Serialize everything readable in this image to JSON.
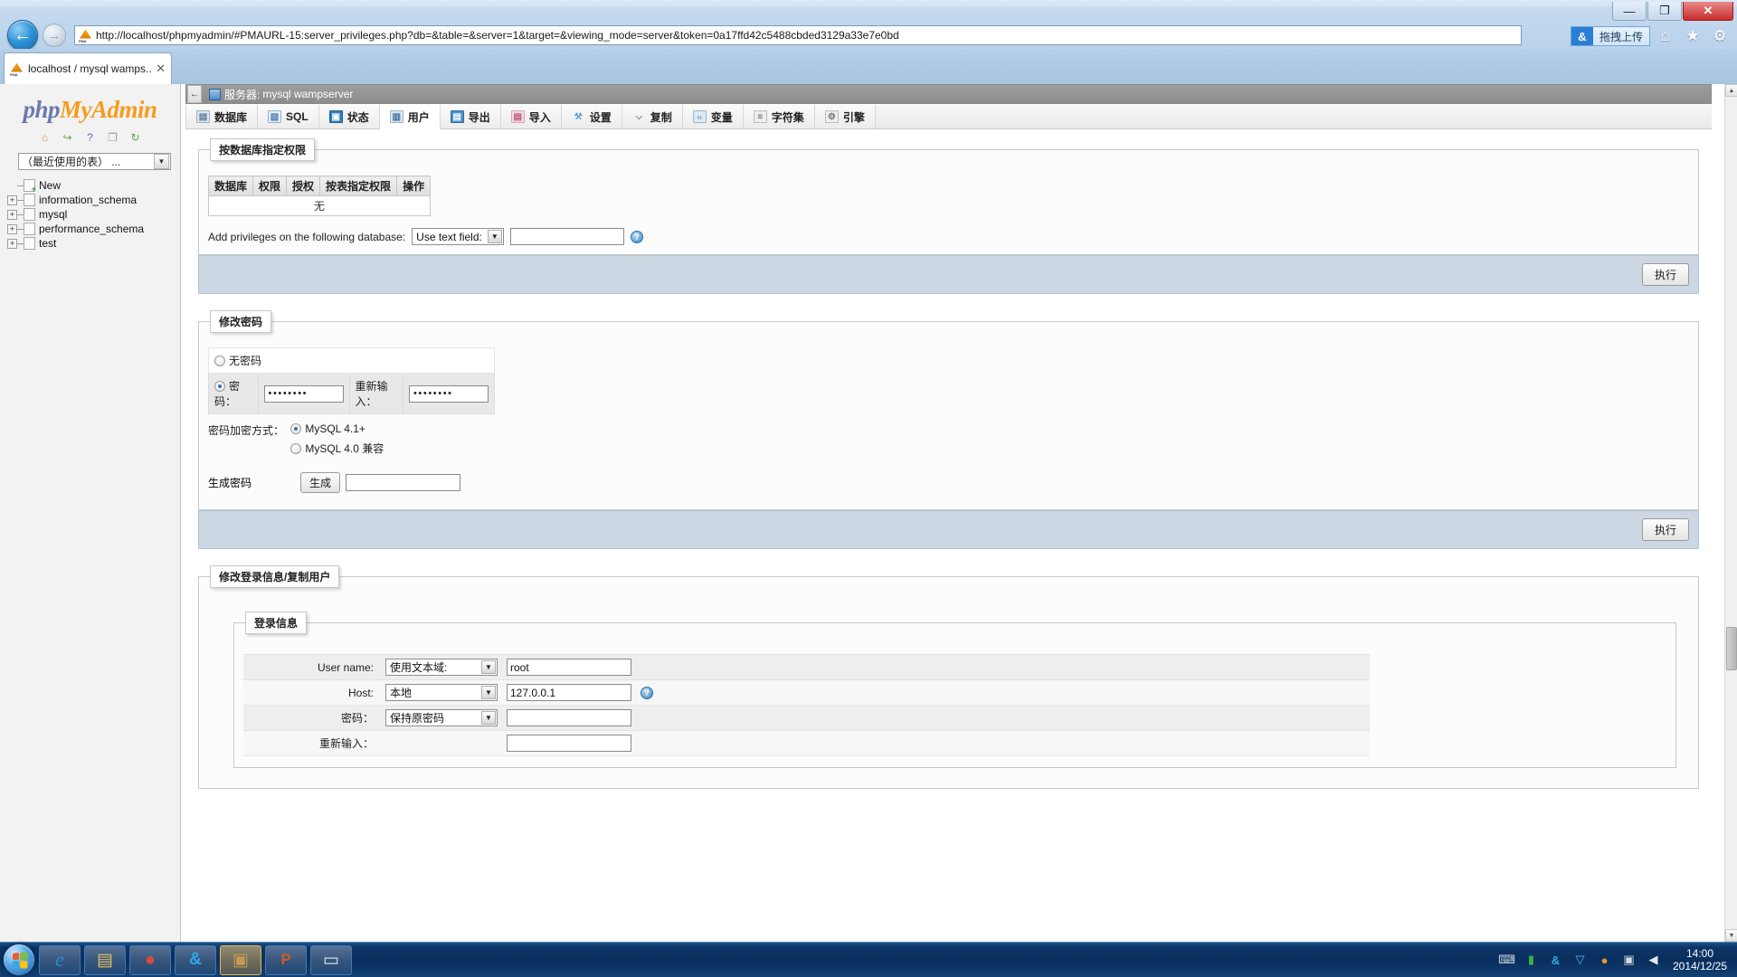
{
  "browser": {
    "window_controls": {
      "minimize": "—",
      "maximize": "❐",
      "close": "✕"
    },
    "back_icon": "←",
    "forward_icon": "→",
    "url": "http://localhost/phpmyadmin/#PMAURL-15:server_privileges.php?db=&table=&server=1&target=&viewing_mode=server&token=0a17ffd42c5488cbded3129a33e7e0bd",
    "tab_title": "localhost / mysql wamps...",
    "tab_close": "✕",
    "baidu_button": "拖拽上传",
    "baidu_icon_glyph": "&",
    "tools": {
      "home": "⌂",
      "favorites": "★",
      "settings": "⚙"
    }
  },
  "sidebar": {
    "logo": {
      "php": "php",
      "my": "My",
      "admin": "Admin"
    },
    "icons": [
      {
        "name": "home-icon",
        "glyph": "⌂"
      },
      {
        "name": "logout-icon",
        "glyph": "↪"
      },
      {
        "name": "help-icon",
        "glyph": "?"
      },
      {
        "name": "docs-icon",
        "glyph": "❐"
      },
      {
        "name": "reload-icon",
        "glyph": "↻"
      }
    ],
    "recent_tables_select": "（最近使用的表） ...",
    "select_arrow": "▼",
    "tree": [
      {
        "label": "New",
        "expandable": false,
        "is_new": true
      },
      {
        "label": "information_schema",
        "expandable": true,
        "is_new": false
      },
      {
        "label": "mysql",
        "expandable": true,
        "is_new": false
      },
      {
        "label": "performance_schema",
        "expandable": true,
        "is_new": false
      },
      {
        "label": "test",
        "expandable": true,
        "is_new": false
      }
    ],
    "expand_glyph": "+"
  },
  "server_header": {
    "collapse_glyph": "←",
    "label": "服务器:",
    "value": "mysql wampserver"
  },
  "nav_tabs": [
    {
      "label": "数据库",
      "icon": "database-icon",
      "glyph": "▤",
      "color": "#7b93ab",
      "active": false
    },
    {
      "label": "SQL",
      "icon": "sql-icon",
      "glyph": "▧",
      "color": "#6d8ba8",
      "active": false
    },
    {
      "label": "状态",
      "icon": "status-icon",
      "glyph": "▣",
      "color": "#2f7fbf",
      "active": false
    },
    {
      "label": "用户",
      "icon": "users-icon",
      "glyph": "▥",
      "color": "#5b7ea1",
      "active": true
    },
    {
      "label": "导出",
      "icon": "export-icon",
      "glyph": "▤",
      "color": "#4a90c8",
      "active": false
    },
    {
      "label": "导入",
      "icon": "import-icon",
      "glyph": "▤",
      "color": "#c2557a",
      "active": false
    },
    {
      "label": "设置",
      "icon": "settings-icon",
      "glyph": "⚒",
      "color": "#7aa3cc",
      "active": false
    },
    {
      "label": "复制",
      "icon": "replication-icon",
      "glyph": "⌵",
      "color": "#8a8a8a",
      "active": false
    },
    {
      "label": "变量",
      "icon": "variables-icon",
      "glyph": "‹›",
      "color": "#4a8fc0",
      "active": false
    },
    {
      "label": "字符集",
      "icon": "charset-icon",
      "glyph": "≡",
      "color": "#8a8a8a",
      "active": false
    },
    {
      "label": "引擎",
      "icon": "engines-icon",
      "glyph": "⚙",
      "color": "#9a9a9a",
      "active": false
    }
  ],
  "db_privileges": {
    "legend": "按数据库指定权限",
    "columns": [
      "数据库",
      "权限",
      "授权",
      "按表指定权限",
      "操作"
    ],
    "empty_text": "无",
    "add_label": "Add privileges on the following database:",
    "add_select_value": "Use text field:",
    "add_input_value": "",
    "help_glyph": "?",
    "submit_label": "执行"
  },
  "change_password": {
    "legend": "修改密码",
    "no_password_label": "无密码",
    "no_password_checked": false,
    "password_label": "密码：",
    "password_checked": true,
    "password_value": "••••••••",
    "reenter_label": "重新输入：",
    "reenter_value": "••••••••",
    "encryption_label": "密码加密方式：",
    "encryption_options": [
      {
        "label": "MySQL 4.1+",
        "checked": true
      },
      {
        "label": "MySQL 4.0 兼容",
        "checked": false
      }
    ],
    "generate_label": "生成密码",
    "generate_button": "生成",
    "generate_value": "",
    "submit_label": "执行"
  },
  "change_login": {
    "legend": "修改登录信息/复制用户",
    "inner_legend": "登录信息",
    "rows": [
      {
        "label": "User name:",
        "select": "使用文本域:",
        "value": "root",
        "has_help": false
      },
      {
        "label": "Host:",
        "select": "本地",
        "value": "127.0.0.1",
        "has_help": true
      },
      {
        "label": "密码：",
        "select": "保持原密码",
        "value": "",
        "has_help": false
      },
      {
        "label": "重新输入：",
        "select": null,
        "value": "",
        "has_help": false
      }
    ],
    "help_glyph": "?"
  },
  "scrollbar": {
    "up_glyph": "▲",
    "down_glyph": "▼"
  },
  "taskbar": {
    "items": [
      {
        "name": "internet-explorer",
        "glyph": "e",
        "color": "#2a8ad4",
        "active": false
      },
      {
        "name": "file-explorer",
        "glyph": "▤",
        "color": "#e8c060",
        "active": false
      },
      {
        "name": "google-chrome",
        "glyph": "●",
        "color": "#d74b3e",
        "active": false
      },
      {
        "name": "baidu-netdisk",
        "glyph": "&",
        "color": "#2fa8e8",
        "active": false
      },
      {
        "name": "photo-viewer",
        "glyph": "▣",
        "color": "#c89a50",
        "active": true
      },
      {
        "name": "powerpoint",
        "glyph": "P",
        "color": "#d05a28",
        "active": false
      },
      {
        "name": "notepad-app",
        "glyph": "▭",
        "color": "#dfe6ee",
        "active": false
      }
    ],
    "tray": [
      {
        "name": "keyboard-ime-icon",
        "glyph": "⌨",
        "color": "#cfd8e4"
      },
      {
        "name": "green-shield-icon",
        "glyph": "▮",
        "color": "#3fae3f"
      },
      {
        "name": "baidu-tray-icon",
        "glyph": "&",
        "color": "#2fa8e8"
      },
      {
        "name": "security-shield-icon",
        "glyph": "▽",
        "color": "#49c0e8"
      },
      {
        "name": "qq-penguin-icon",
        "glyph": "●",
        "color": "#e8943a"
      },
      {
        "name": "network-icon",
        "glyph": "▣",
        "color": "#d8dde4"
      },
      {
        "name": "volume-icon",
        "glyph": "◀",
        "color": "#e4e9f0"
      }
    ],
    "clock_time": "14:00",
    "clock_date": "2014/12/25"
  }
}
